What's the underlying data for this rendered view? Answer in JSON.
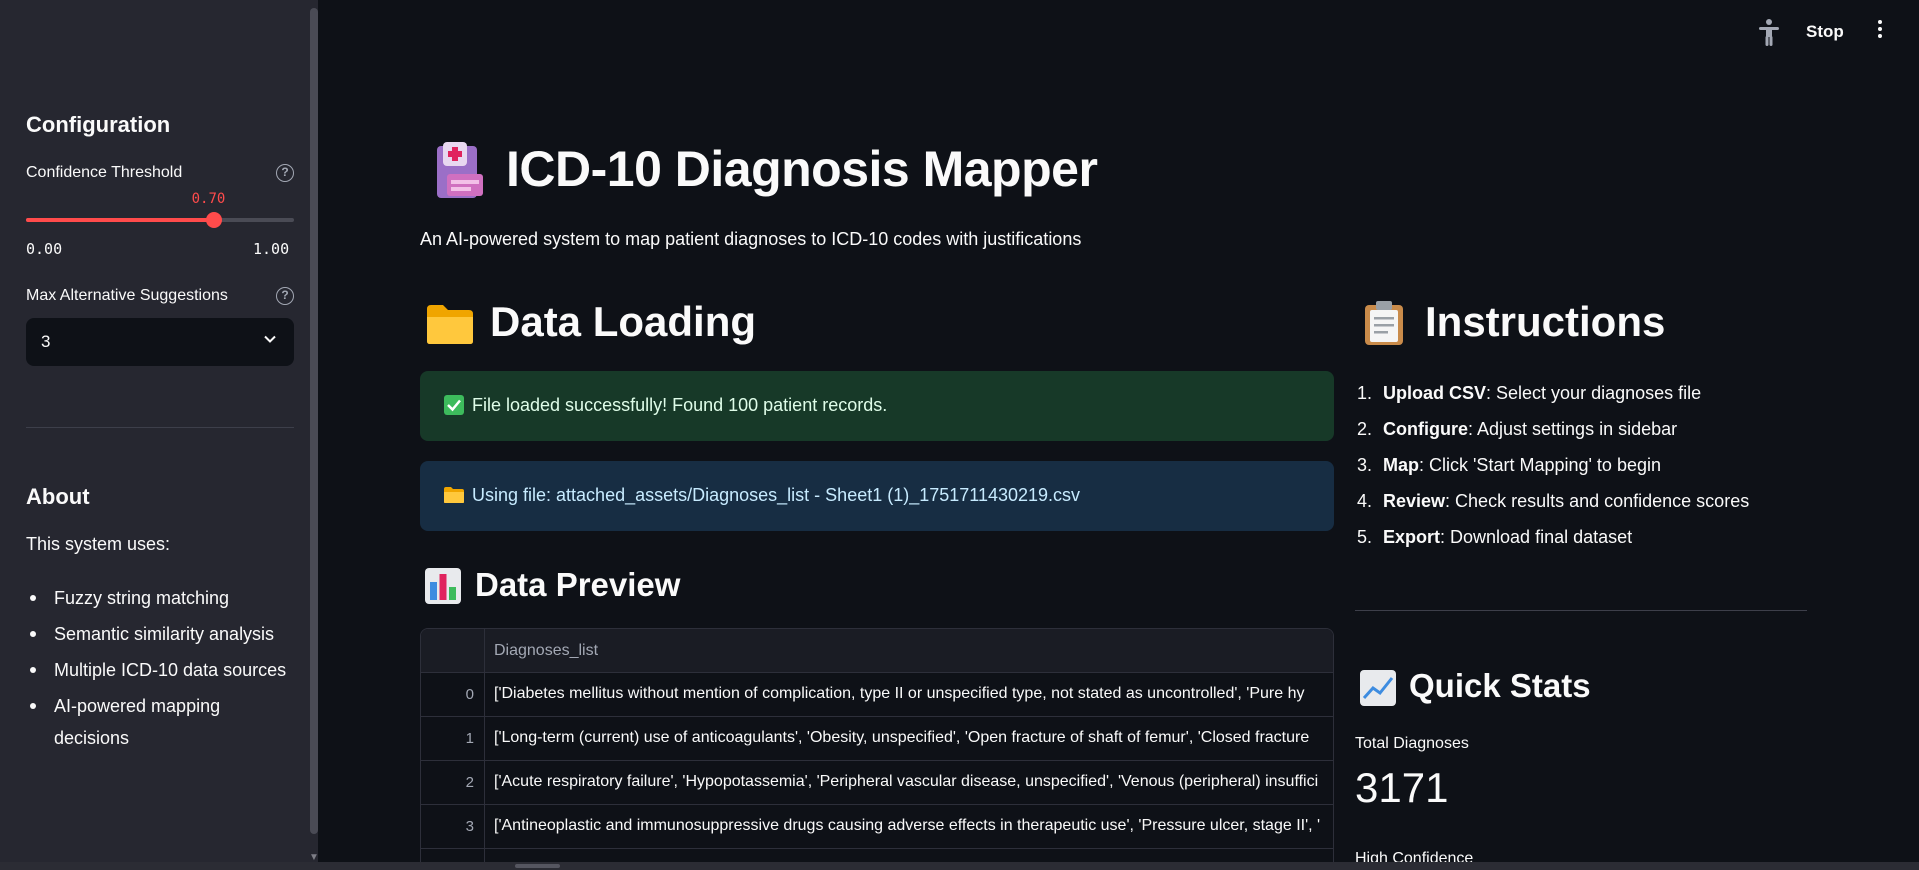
{
  "topbar": {
    "stop_label": "Stop"
  },
  "sidebar": {
    "config_heading": "Configuration",
    "confidence_label": "Confidence Threshold",
    "confidence_value": "0.70",
    "confidence_fraction": 0.7,
    "confidence_min": "0.00",
    "confidence_max": "1.00",
    "max_alt_label": "Max Alternative Suggestions",
    "max_alt_value": "3",
    "about_heading": "About",
    "about_intro": "This system uses:",
    "about_items": [
      "Fuzzy string matching",
      "Semantic similarity analysis",
      "Multiple ICD-10 data sources",
      "AI-powered mapping decisions"
    ]
  },
  "main": {
    "title": "ICD-10 Diagnosis Mapper",
    "subtitle": "An AI-powered system to map patient diagnoses to ICD-10 codes with justifications",
    "data_loading_heading": "Data Loading",
    "success_text": "File loaded successfully! Found 100 patient records.",
    "info_text": "Using file: attached_assets/Diagnoses_list - Sheet1 (1)_1751711430219.csv",
    "preview_heading": "Data Preview",
    "table": {
      "column": "Diagnoses_list",
      "rows": [
        {
          "index": "0",
          "value": "['Diabetes mellitus without mention of complication, type II or unspecified type, not stated as uncontrolled', 'Pure hy"
        },
        {
          "index": "1",
          "value": "['Long-term (current) use of anticoagulants', 'Obesity, unspecified', 'Open fracture of shaft of femur', 'Closed fracture"
        },
        {
          "index": "2",
          "value": "['Acute respiratory failure', 'Hypopotassemia', 'Peripheral vascular disease, unspecified', 'Venous (peripheral) insuffici"
        },
        {
          "index": "3",
          "value": "['Antineoplastic and immunosuppressive drugs causing adverse effects in therapeutic use', 'Pressure ulcer, stage II', '"
        }
      ]
    },
    "instructions_heading": "Instructions",
    "instructions": [
      {
        "num": "1.",
        "bold": "Upload CSV",
        "rest": ": Select your diagnoses file"
      },
      {
        "num": "2.",
        "bold": "Configure",
        "rest": ": Adjust settings in sidebar"
      },
      {
        "num": "3.",
        "bold": "Map",
        "rest": ": Click 'Start Mapping' to begin"
      },
      {
        "num": "4.",
        "bold": "Review",
        "rest": ": Check results and confidence scores"
      },
      {
        "num": "5.",
        "bold": "Export",
        "rest": ": Download final dataset"
      }
    ],
    "quick_stats_heading": "Quick Stats",
    "total_diagnoses_label": "Total Diagnoses",
    "total_diagnoses_value": "3171",
    "high_confidence_label": "High Confidence"
  },
  "colors": {
    "accent": "#ff4b4b",
    "success_bg": "#173928",
    "info_bg": "#172d43"
  },
  "icons": [
    "accessibility-icon",
    "more-vert-icon",
    "hospital-icon",
    "folder-icon",
    "clipboard-icon",
    "bar-chart-icon",
    "trend-chart-icon",
    "check-icon",
    "help-icon",
    "chevron-down-icon"
  ]
}
